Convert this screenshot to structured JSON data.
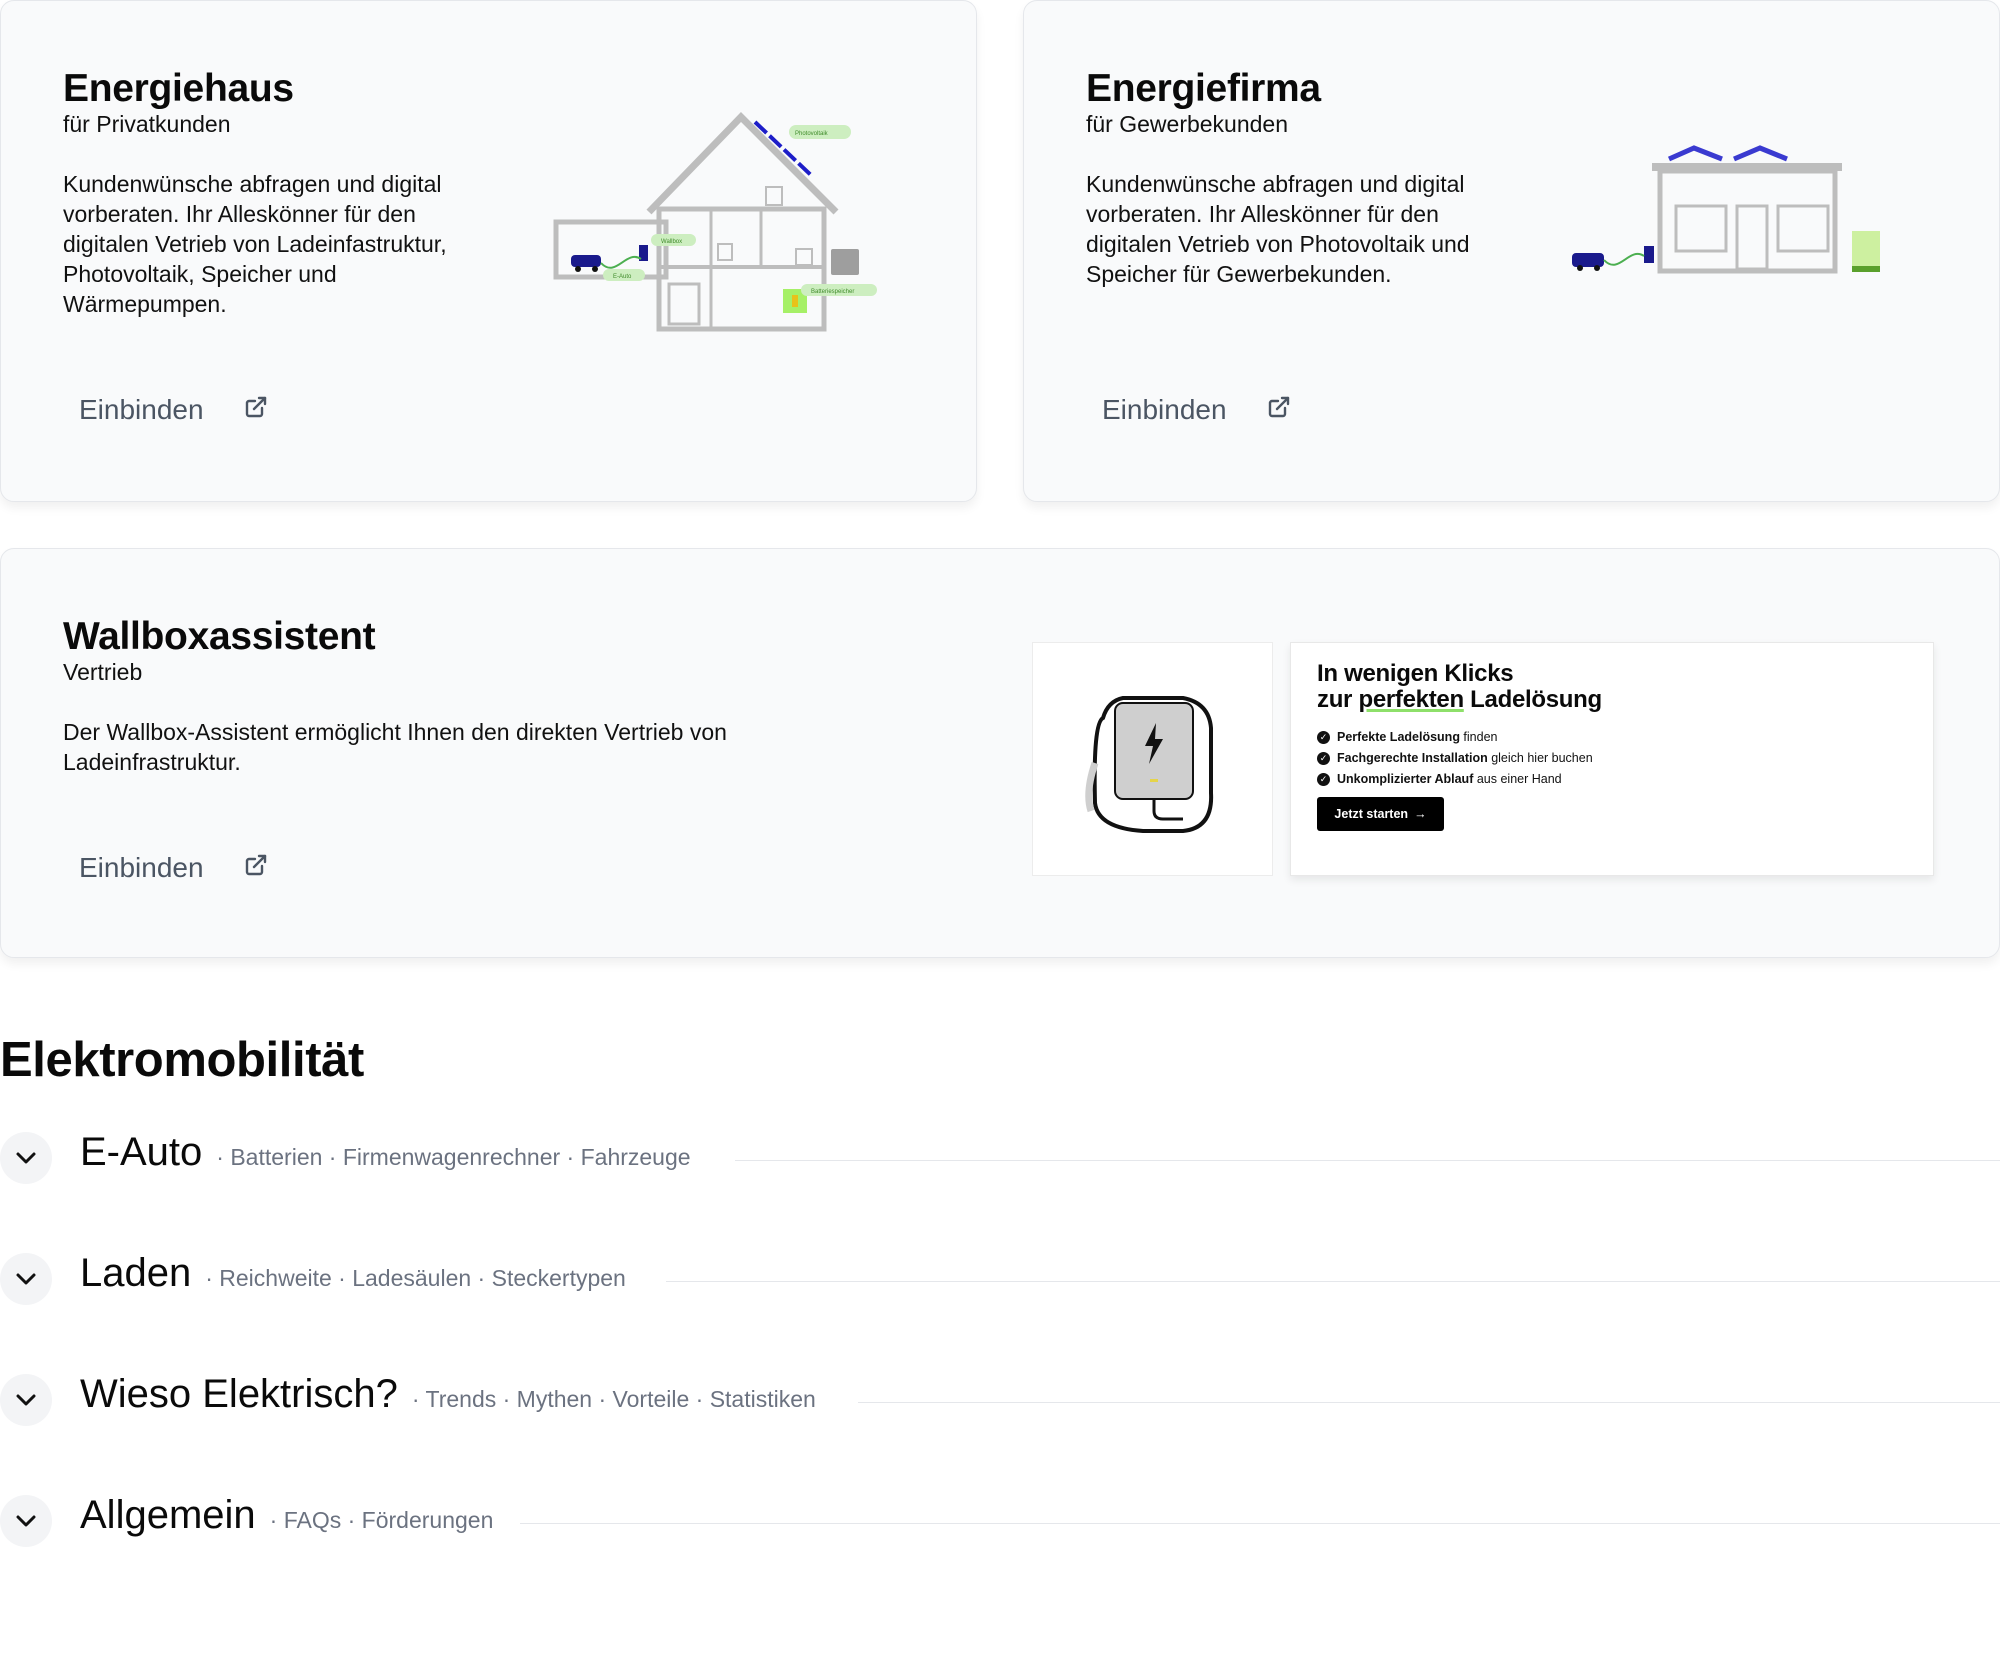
{
  "cards": [
    {
      "title": "Energiehaus",
      "subtitle": "für Privatkunden",
      "description": "Kundenwünsche abfragen und digital vorberaten. Ihr Alleskönner für den digitalen Vetrieb von Ladeinfastruktur, Photovoltaik, Speicher und Wärmepumpen.",
      "action": "Einbinden",
      "illustration_labels": [
        "Photovoltaik",
        "Wallbox",
        "E-Auto",
        "Batteriespeicher"
      ]
    },
    {
      "title": "Energiefirma",
      "subtitle": "für Gewerbekunden",
      "description": "Kundenwünsche abfragen und digital vorberaten. Ihr Alleskönner für den digitalen Vetrieb von Photovoltaik und Speicher für Gewerbekunden.",
      "action": "Einbinden"
    },
    {
      "title": "Wallboxassistent",
      "subtitle": "Vertrieb",
      "description": "Der Wallbox-Assistent ermöglicht Ihnen den direkten Vertrieb von Ladeinfrastruktur.",
      "action": "Einbinden"
    }
  ],
  "promo": {
    "title_line1": "In wenigen Klicks",
    "title_pre": "zur ",
    "title_highlight": "perfekten",
    "title_post": " Ladelösung",
    "items": [
      {
        "bold": "Perfekte Ladelösung",
        "rest": " finden"
      },
      {
        "bold": "Fachgerechte Installation",
        "rest": " gleich hier buchen"
      },
      {
        "bold": "Unkomplizierter Ablauf",
        "rest": " aus einer Hand"
      }
    ],
    "cta": "Jetzt starten",
    "cta_icon": "arrow-right-icon"
  },
  "section_title": "Elektromobilität",
  "accordion": [
    {
      "title": "E-Auto",
      "tags": "· Batterien · Firmenwagenrechner · Fahrzeuge"
    },
    {
      "title": "Laden",
      "tags": "· Reichweite · Ladesäulen · Steckertypen"
    },
    {
      "title": "Wieso Elektrisch?",
      "tags": "· Trends · Mythen · Vorteile · Statistiken"
    },
    {
      "title": "Allgemein",
      "tags": "· FAQs · Förderungen"
    }
  ],
  "colors": {
    "accent_green": "#8ee06a",
    "navy": "#1a1a8c",
    "blue": "#3a3ad0",
    "muted": "#6b7280"
  }
}
